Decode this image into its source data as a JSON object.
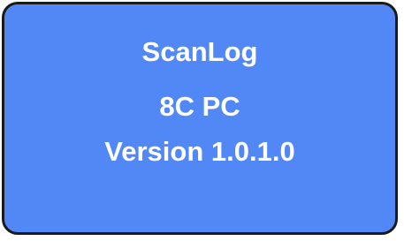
{
  "splash": {
    "app_name": "ScanLog",
    "model": "8C PC",
    "version": "Version 1.0.1.0"
  },
  "colors": {
    "background": "#5287f6",
    "border": "#1a1a1a",
    "text": "#ffffff"
  }
}
